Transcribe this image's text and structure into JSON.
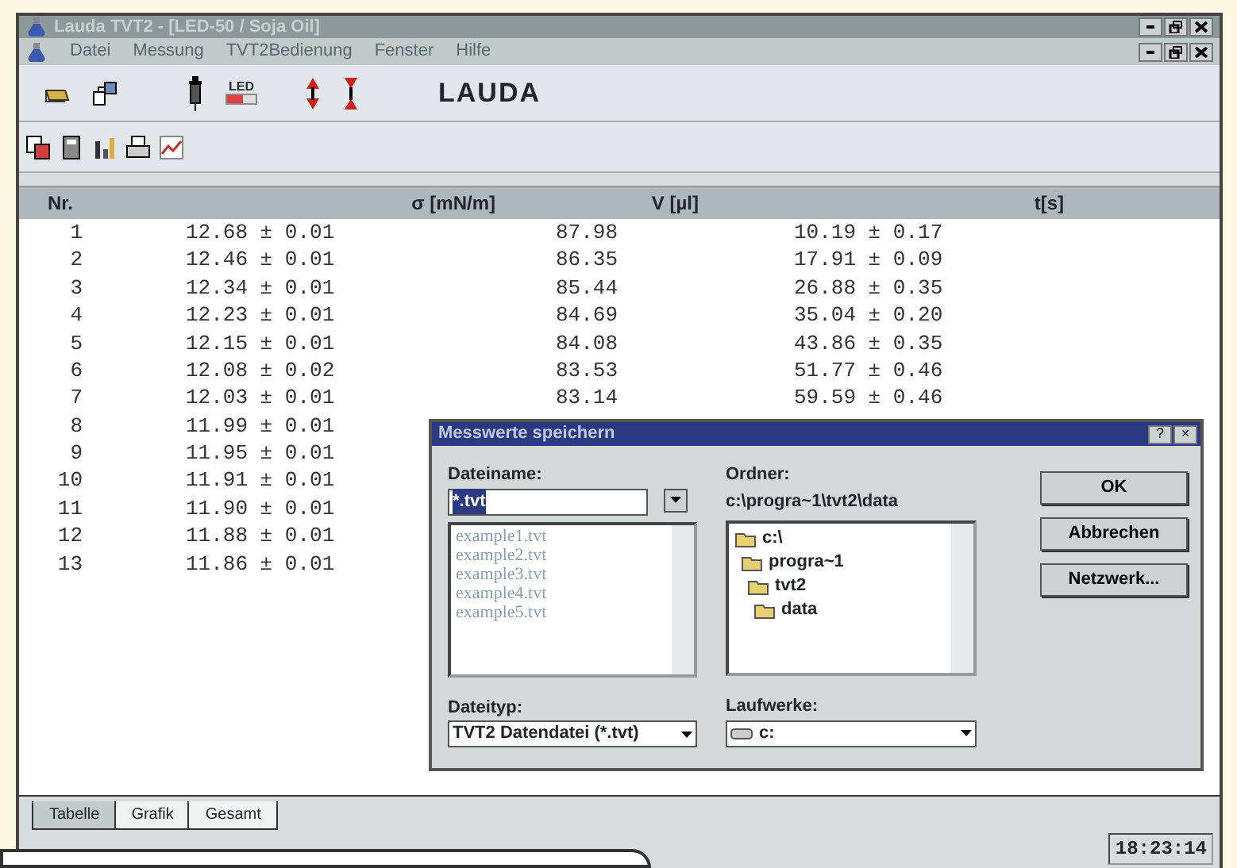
{
  "window": {
    "title": "Lauda TVT2 - [LED-50 / Soja Oil]"
  },
  "menu": [
    "Datei",
    "Messung",
    "TVT2Bedienung",
    "Fenster",
    "Hilfe"
  ],
  "toolbar": {
    "led_label": "LED",
    "logo": "LAUDA"
  },
  "table": {
    "columns": [
      "Nr.",
      "σ [mN/m]",
      "V [µl]",
      "t[s]"
    ],
    "rows": [
      {
        "nr": "1",
        "sigma": "12.68 ± 0.01",
        "volume": "87.98",
        "time": "10.19 ± 0.17"
      },
      {
        "nr": "2",
        "sigma": "12.46 ± 0.01",
        "volume": "86.35",
        "time": "17.91 ± 0.09"
      },
      {
        "nr": "3",
        "sigma": "12.34 ± 0.01",
        "volume": "85.44",
        "time": "26.88 ± 0.35"
      },
      {
        "nr": "4",
        "sigma": "12.23 ± 0.01",
        "volume": "84.69",
        "time": "35.04 ± 0.20"
      },
      {
        "nr": "5",
        "sigma": "12.15 ± 0.01",
        "volume": "84.08",
        "time": "43.86 ± 0.35"
      },
      {
        "nr": "6",
        "sigma": "12.08 ± 0.02",
        "volume": "83.53",
        "time": "51.77 ± 0.46"
      },
      {
        "nr": "7",
        "sigma": "12.03 ± 0.01",
        "volume": "83.14",
        "time": "59.59 ± 0.46"
      },
      {
        "nr": "8",
        "sigma": "11.99 ± 0.01"
      },
      {
        "nr": "9",
        "sigma": "11.95 ± 0.01"
      },
      {
        "nr": "10",
        "sigma": "11.91 ± 0.01"
      },
      {
        "nr": "11",
        "sigma": "11.90 ± 0.01"
      },
      {
        "nr": "12",
        "sigma": "11.88 ± 0.01"
      },
      {
        "nr": "13",
        "sigma": "11.86 ± 0.01"
      }
    ]
  },
  "dialog": {
    "title": "Messwerte speichern",
    "help": "?",
    "close": "×",
    "filename_label": "Dateiname:",
    "filename_value": "*.tvt",
    "files": [
      "example1.tvt",
      "example2.tvt",
      "example3.tvt",
      "example4.tvt",
      "example5.tvt"
    ],
    "folder_label": "Ordner:",
    "folder_path": "c:\\progra~1\\tvt2\\data",
    "folders": [
      {
        "name": "c:\\",
        "children": [
          {
            "name": "progra~1",
            "children": [
              {
                "name": "tvt2",
                "children": [
                  {
                    "name": "data"
                  }
                ]
              }
            ]
          }
        ]
      }
    ],
    "filetype_label": "Dateityp:",
    "filetype_value": "TVT2 Datendatei (*.tvt)",
    "drives_label": "Laufwerke:",
    "drive_value": "c:",
    "buttons": [
      "OK",
      "Abbrechen",
      "Netzwerk..."
    ]
  },
  "tabs": [
    {
      "label": "Tabelle",
      "selected": true
    },
    {
      "label": "Grafik",
      "selected": false
    },
    {
      "label": "Gesamt",
      "selected": false
    }
  ],
  "status_bar": {
    "time": "18:23:14"
  }
}
